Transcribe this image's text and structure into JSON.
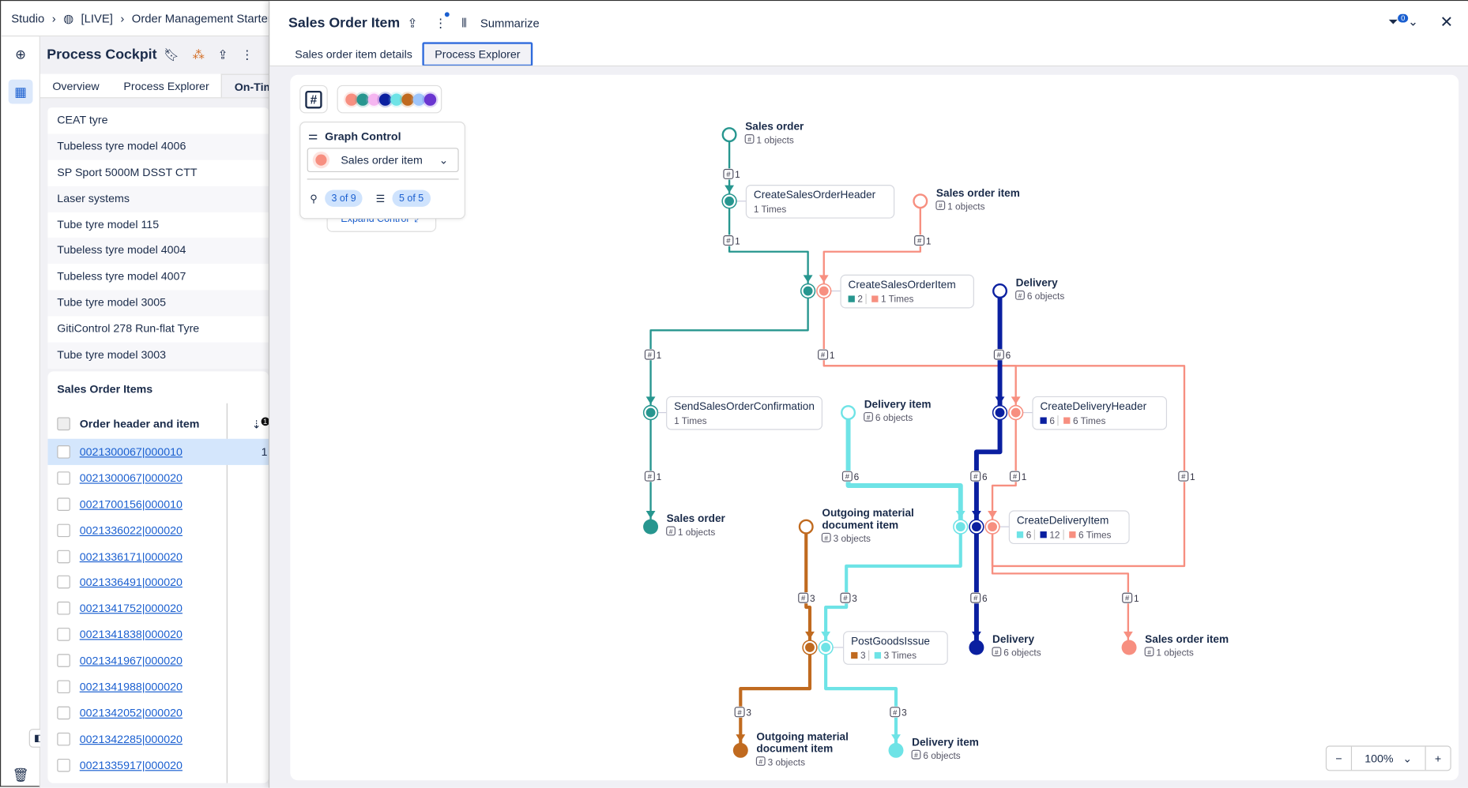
{
  "breadcrumb": {
    "items": [
      "Studio",
      "[LIVE]",
      "Order Management Starter"
    ]
  },
  "left": {
    "title": "Process Cockpit",
    "tabs": [
      "Overview",
      "Process Explorer",
      "On-Time"
    ],
    "list": [
      "CEAT tyre",
      "Tubeless tyre model 4006",
      "SP Sport 5000M DSST CTT",
      "Laser systems",
      "Tube tyre model 115",
      "Tubeless tyre model 4004",
      "Tubeless tyre model 4007",
      "Tube tyre model 3005",
      "GitiControl 278 Run-flat Tyre",
      "Tube tyre model 3003"
    ],
    "table": {
      "title": "Sales Order Items",
      "column": "Order header and item",
      "sort_badge": "1",
      "first_row_value": "1",
      "rows": [
        "0021300067|000010",
        "0021300067|000020",
        "0021700156|000010",
        "0021336022|000020",
        "0021336171|000020",
        "0021336491|000020",
        "0021341752|000020",
        "0021341838|000020",
        "0021341967|000020",
        "0021341988|000020",
        "0021342052|000020",
        "0021342285|000020",
        "0021335917|000020"
      ]
    }
  },
  "panel": {
    "title": "Sales Order Item",
    "summarize": "Summarize",
    "filter_count": "0",
    "tabs": [
      "Sales order item details",
      "Process Explorer"
    ],
    "active_tab": "Process Explorer",
    "hash_button": "#",
    "palette": [
      "#f78f80",
      "#27968f",
      "#f5b5f0",
      "#0a1fa0",
      "#6ee3e6",
      "#c06a1f",
      "#9ec5fb",
      "#6a35d0"
    ],
    "graph_control": {
      "title": "Graph Control",
      "selected_object": "Sales order item",
      "selected_color": "#f78f80",
      "paths": "3 of 9",
      "attributes": "5 of 5",
      "expand": "Expand Control"
    },
    "zoom": {
      "minus": "−",
      "level": "100%",
      "plus": "+"
    }
  },
  "colors": {
    "sales_order": "#27968f",
    "sales_order_item": "#f78f80",
    "delivery": "#0a1fa0",
    "delivery_item": "#6ee3e6",
    "outgoing": "#c06a1f"
  },
  "graph": {
    "objects": [
      {
        "name": "Sales order",
        "count": "1 objects",
        "type": "sales_order",
        "kind": "start"
      },
      {
        "name": "Sales order item",
        "count": "1 objects",
        "type": "sales_order_item",
        "kind": "start"
      },
      {
        "name": "Delivery",
        "count": "6 objects",
        "type": "delivery",
        "kind": "start"
      },
      {
        "name": "Delivery item",
        "count": "6 objects",
        "type": "delivery_item",
        "kind": "start"
      },
      {
        "name": "Outgoing material document item",
        "count": "3 objects",
        "type": "outgoing",
        "kind": "start"
      },
      {
        "name": "Sales order",
        "count": "1 objects",
        "type": "sales_order",
        "kind": "end"
      },
      {
        "name": "Delivery",
        "count": "6 objects",
        "type": "delivery",
        "kind": "end"
      },
      {
        "name": "Sales order item",
        "count": "1 objects",
        "type": "sales_order_item",
        "kind": "end"
      },
      {
        "name": "Outgoing material document item",
        "count": "3 objects",
        "type": "outgoing",
        "kind": "end"
      },
      {
        "name": "Delivery item",
        "count": "6 objects",
        "type": "delivery_item",
        "kind": "end"
      }
    ],
    "activities": [
      {
        "name": "CreateSalesOrderHeader",
        "types": [
          "sales_order"
        ],
        "counts": [],
        "times": "1 Times"
      },
      {
        "name": "CreateSalesOrderItem",
        "types": [
          "sales_order",
          "sales_order_item"
        ],
        "counts": [
          {
            "type": "sales_order",
            "value": "2"
          }
        ],
        "times_type": "sales_order_item",
        "times": "1 Times"
      },
      {
        "name": "SendSalesOrderConfirmation",
        "types": [
          "sales_order"
        ],
        "counts": [],
        "times": "1 Times"
      },
      {
        "name": "CreateDeliveryHeader",
        "types": [
          "delivery",
          "sales_order_item"
        ],
        "counts": [
          {
            "type": "delivery",
            "value": "6"
          }
        ],
        "times_type": "sales_order_item",
        "times": "6 Times"
      },
      {
        "name": "CreateDeliveryItem",
        "types": [
          "delivery_item",
          "delivery",
          "sales_order_item"
        ],
        "counts": [
          {
            "type": "delivery_item",
            "value": "6"
          },
          {
            "type": "delivery",
            "value": "12"
          }
        ],
        "times_type": "sales_order_item",
        "times": "6 Times"
      },
      {
        "name": "PostGoodsIssue",
        "types": [
          "outgoing",
          "delivery_item"
        ],
        "counts": [
          {
            "type": "outgoing",
            "value": "3"
          }
        ],
        "times_type": "delivery_item",
        "times": "3 Times"
      }
    ],
    "edges": [
      {
        "type": "sales_order",
        "label": "1"
      },
      {
        "type": "sales_order",
        "label": "1"
      },
      {
        "type": "sales_order_item",
        "label": "1"
      },
      {
        "type": "sales_order",
        "label": "1"
      },
      {
        "type": "sales_order_item",
        "label": "1"
      },
      {
        "type": "sales_order_item",
        "label": "1"
      },
      {
        "type": "delivery",
        "label": "6"
      },
      {
        "type": "delivery",
        "label": "6"
      },
      {
        "type": "sales_order_item",
        "label": "1"
      },
      {
        "type": "delivery_item",
        "label": "6"
      },
      {
        "type": "delivery_item",
        "label": "3"
      },
      {
        "type": "delivery",
        "label": "6"
      },
      {
        "type": "sales_order_item",
        "label": "1"
      },
      {
        "type": "outgoing",
        "label": "3"
      },
      {
        "type": "outgoing",
        "label": "3"
      },
      {
        "type": "delivery_item",
        "label": "3"
      },
      {
        "type": "sales_order",
        "label": "1"
      }
    ]
  }
}
